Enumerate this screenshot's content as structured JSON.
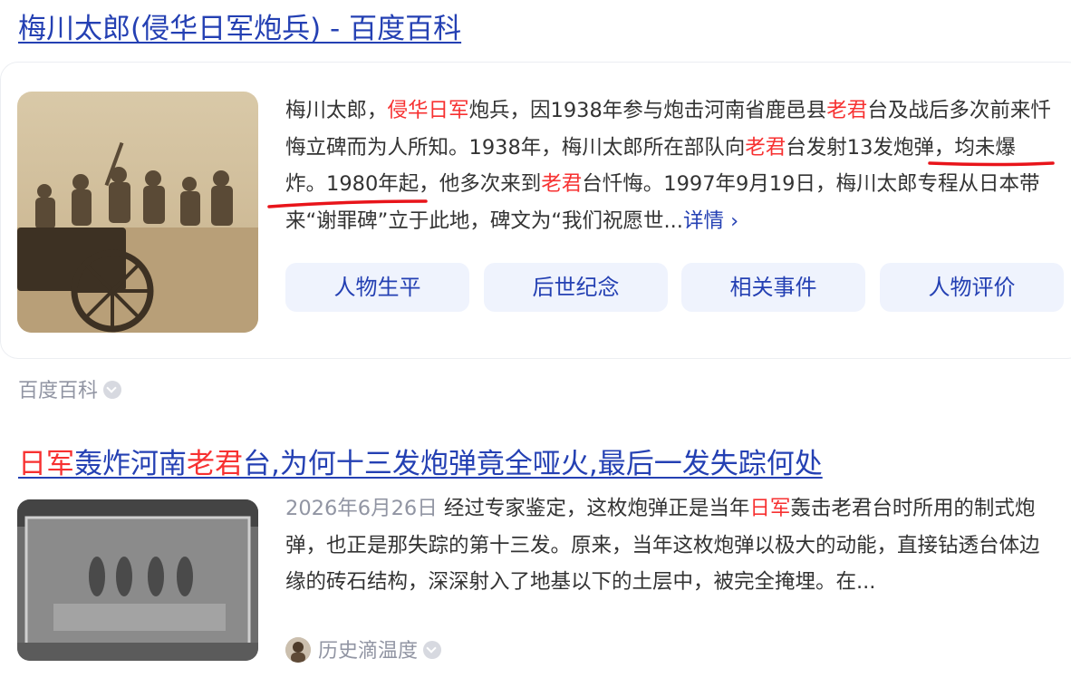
{
  "result1": {
    "title": "梅川太郎(侵华日军炮兵) - 百度百科",
    "abstract": [
      {
        "text": "梅川太郎，",
        "hl": false
      },
      {
        "text": "侵华日军",
        "hl": true
      },
      {
        "text": "炮兵，因1938年参与炮击河南省鹿邑县",
        "hl": false
      },
      {
        "text": "老君",
        "hl": true
      },
      {
        "text": "台及战后多次前来忏悔立碑而为人所知。1938年，梅川太郎所在部队向",
        "hl": false
      },
      {
        "text": "老君",
        "hl": true
      },
      {
        "text": "台发射13发炮弹，均未爆炸。1980年起，他多次来到",
        "hl": false
      },
      {
        "text": "老君",
        "hl": true
      },
      {
        "text": "台忏悔。1997年9月19日，梅川太郎专程从日本带来“谢罪碑”立于此地，碑文为“我们祝愿世...",
        "hl": false
      }
    ],
    "more_label": "详情 ›",
    "tabs": [
      "人物生平",
      "后世纪念",
      "相关事件",
      "人物评价"
    ],
    "source": "百度百科"
  },
  "result2": {
    "title": [
      {
        "text": "日军",
        "hl": true
      },
      {
        "text": "轰炸河南",
        "hl": false
      },
      {
        "text": "老君",
        "hl": true
      },
      {
        "text": "台,为何十三发炮弹竟全哑火,最后一发失踪何处",
        "hl": false
      }
    ],
    "date": "2026年6月26日",
    "abstract": [
      {
        "text": "经过专家鉴定，这枚炮弹正是当年",
        "hl": false
      },
      {
        "text": "日军",
        "hl": true
      },
      {
        "text": "轰击老君台时所用的制式炮弹，也正是那失踪的第十三发。原来，当年这枚炮弹以极大的动能，直接钻透台体边缘的砖石结构，深深射入了地基以下的土层中，被完全掩埋。在...",
        "hl": false
      }
    ],
    "source": "历史滴温度"
  },
  "annotation_color": "#e8141a"
}
